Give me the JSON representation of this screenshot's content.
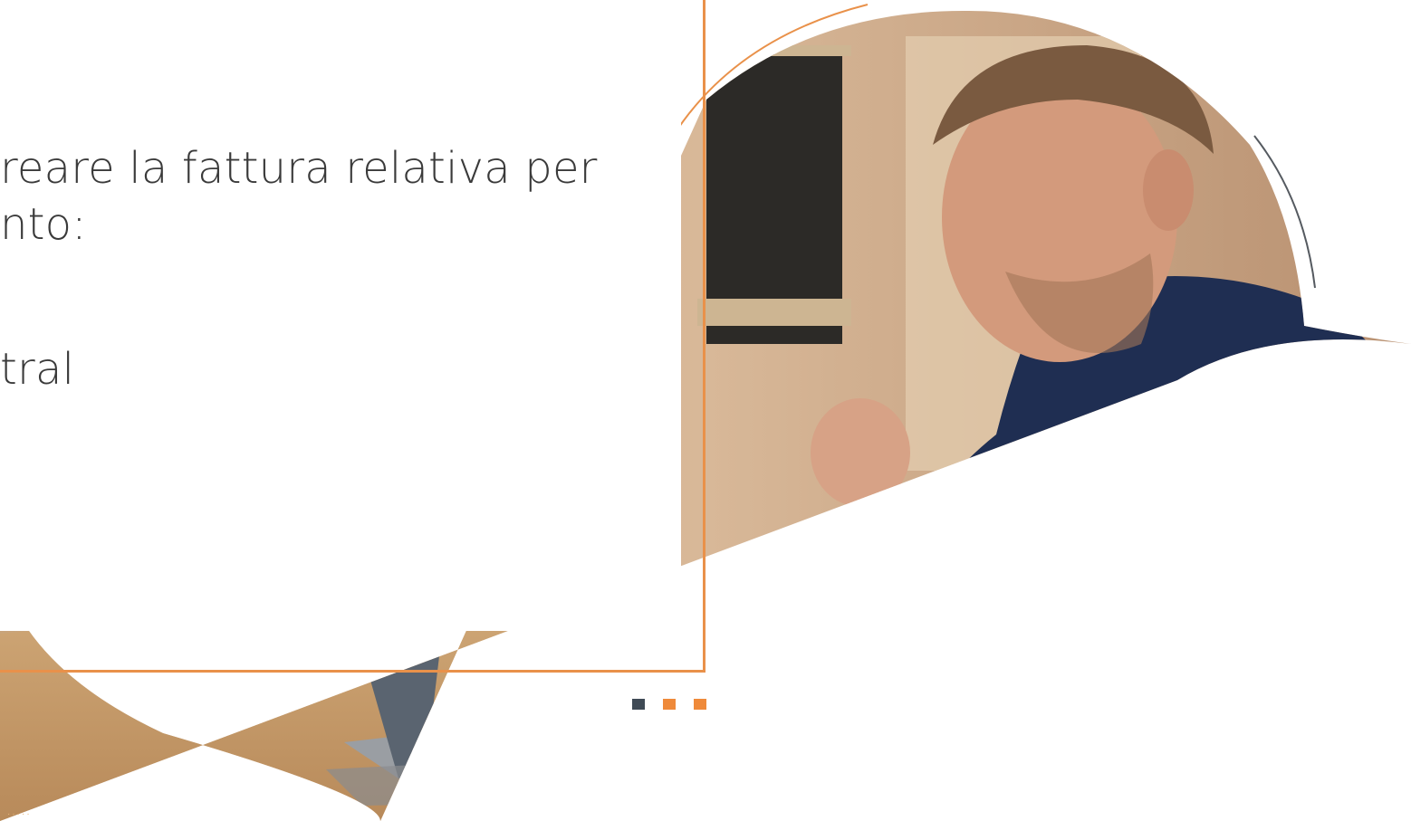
{
  "slide": {
    "lines": [
      "reare la fattura relativa per",
      "nto:",
      "tral"
    ],
    "decor_dots": "·····"
  },
  "colors": {
    "accent_orange": "#e9914a",
    "square_dark": "#3f4a55",
    "square_orange": "#ef8a3a",
    "text": "#3a3a3a"
  },
  "photo": {
    "subject": "man-celebrating-at-laptop-photo"
  }
}
